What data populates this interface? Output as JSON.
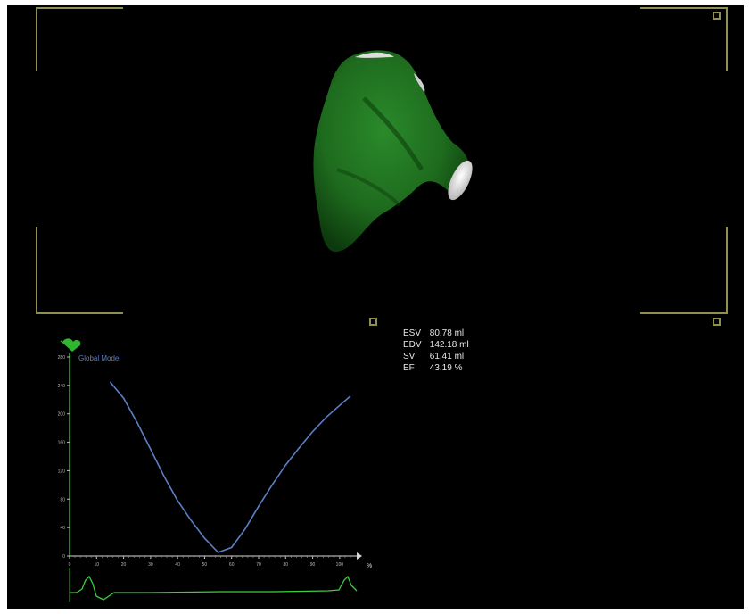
{
  "viewer": {
    "colors": {
      "background": "#000000",
      "frame": "#8f8f52",
      "model": "#1e6b1e",
      "curve": "#5b7fc4",
      "axis": "#2fb52f",
      "text": "#e8e8e8"
    },
    "model_icon": "green-heart-chamber-icon"
  },
  "metrics": [
    {
      "label": "ESV",
      "value": "80.78 ml"
    },
    {
      "label": "EDV",
      "value": "142.18 ml"
    },
    {
      "label": "SV",
      "value": "61.41 ml"
    },
    {
      "label": "EF",
      "value": "43.19 %"
    }
  ],
  "plot": {
    "series_label": "Global Model",
    "x_unit": "%",
    "x_ticks": [
      "0",
      "10",
      "20",
      "30",
      "40",
      "50",
      "60",
      "70",
      "80",
      "90",
      "100"
    ],
    "y_ticks": [
      "0",
      "40",
      "80",
      "120",
      "160",
      "200",
      "240",
      "280"
    ],
    "curve": {
      "x": [
        15,
        20,
        25,
        30,
        35,
        40,
        45,
        50,
        55,
        60,
        65,
        70,
        75,
        80,
        85,
        90,
        95,
        100,
        104
      ],
      "y": [
        245,
        222,
        188,
        150,
        112,
        78,
        50,
        25,
        5,
        12,
        38,
        70,
        100,
        128,
        152,
        175,
        195,
        212,
        225
      ]
    },
    "x_range": [
      0,
      105
    ],
    "y_range": [
      0,
      280
    ]
  }
}
